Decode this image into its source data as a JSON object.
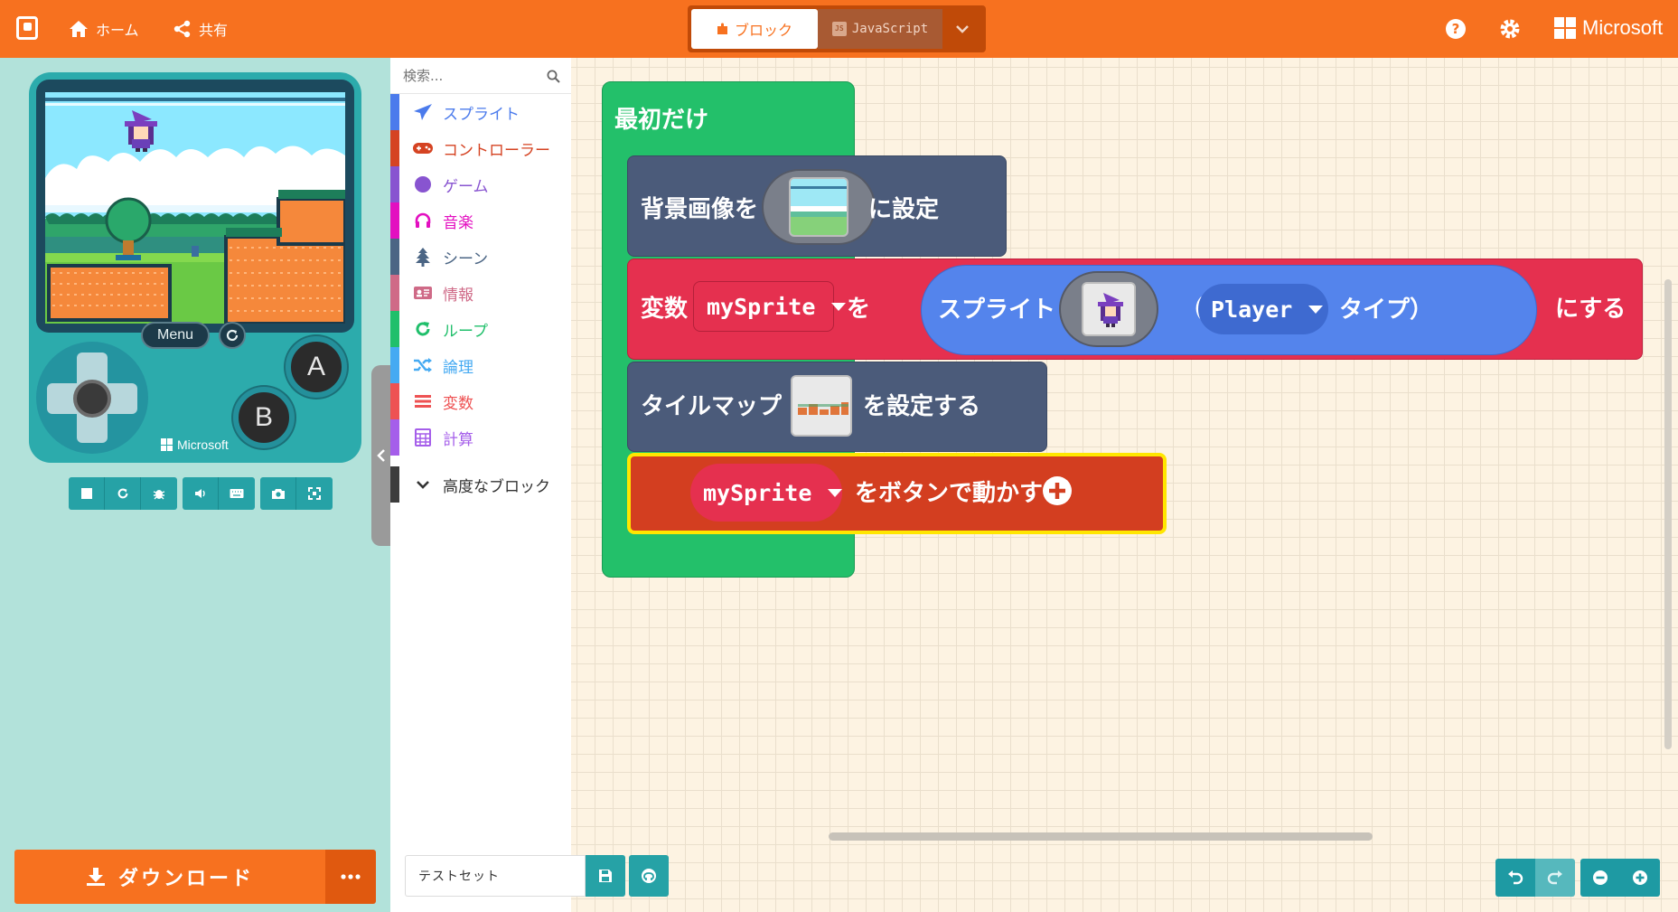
{
  "header": {
    "home_label": "ホーム",
    "share_label": "共有",
    "blocks_tab": "ブロック",
    "js_tab": "JavaScript",
    "js_badge": "JS",
    "brand": "Microsoft"
  },
  "simulator": {
    "menu_label": "Menu",
    "btn_a": "A",
    "btn_b": "B",
    "console_brand": "Microsoft",
    "download_label": "ダウンロード"
  },
  "toolbox": {
    "search_placeholder": "検索...",
    "categories": [
      {
        "label": "スプライト",
        "color": "#4b7bec",
        "icon": "paper-plane-icon"
      },
      {
        "label": "コントローラー",
        "color": "#d54322",
        "icon": "gamepad-icon"
      },
      {
        "label": "ゲーム",
        "color": "#8854d0",
        "icon": "circle-icon"
      },
      {
        "label": "音楽",
        "color": "#e30fc0",
        "icon": "headphones-icon"
      },
      {
        "label": "シーン",
        "color": "#4b6584",
        "icon": "tree-icon"
      },
      {
        "label": "情報",
        "color": "#cf6a87",
        "icon": "id-card-icon"
      },
      {
        "label": "ループ",
        "color": "#20bf6b",
        "icon": "loop-icon"
      },
      {
        "label": "論理",
        "color": "#45aaf2",
        "icon": "shuffle-icon"
      },
      {
        "label": "変数",
        "color": "#ee5253",
        "icon": "list-icon"
      },
      {
        "label": "計算",
        "color": "#a55eea",
        "icon": "calculator-icon"
      }
    ],
    "advanced_label": "高度なブロック"
  },
  "workspace": {
    "on_start": "最初だけ",
    "set_bg_prefix": "背景画像を",
    "set_bg_suffix": "に設定",
    "var_prefix": "変数",
    "var_name": "mySprite",
    "var_wo": "を",
    "sprite_label": "スプライト",
    "paren_open": "（",
    "kind_value": "Player",
    "kind_suffix": "タイプ）",
    "var_suffix": "にする",
    "tilemap_prefix": "タイルマップ",
    "tilemap_suffix": "を設定する",
    "move_sprite": "mySprite",
    "move_suffix": "をボタンで動かす"
  },
  "footer": {
    "project_name": "テストセット"
  },
  "colors": {
    "accent": "#f7711f",
    "teal": "#26a2a6",
    "on_start": "#23c06a",
    "scene_block": "#4b5b7a",
    "variables_block": "#e5304f",
    "sprites_block": "#5484ec",
    "controller_block": "#d33e20"
  }
}
